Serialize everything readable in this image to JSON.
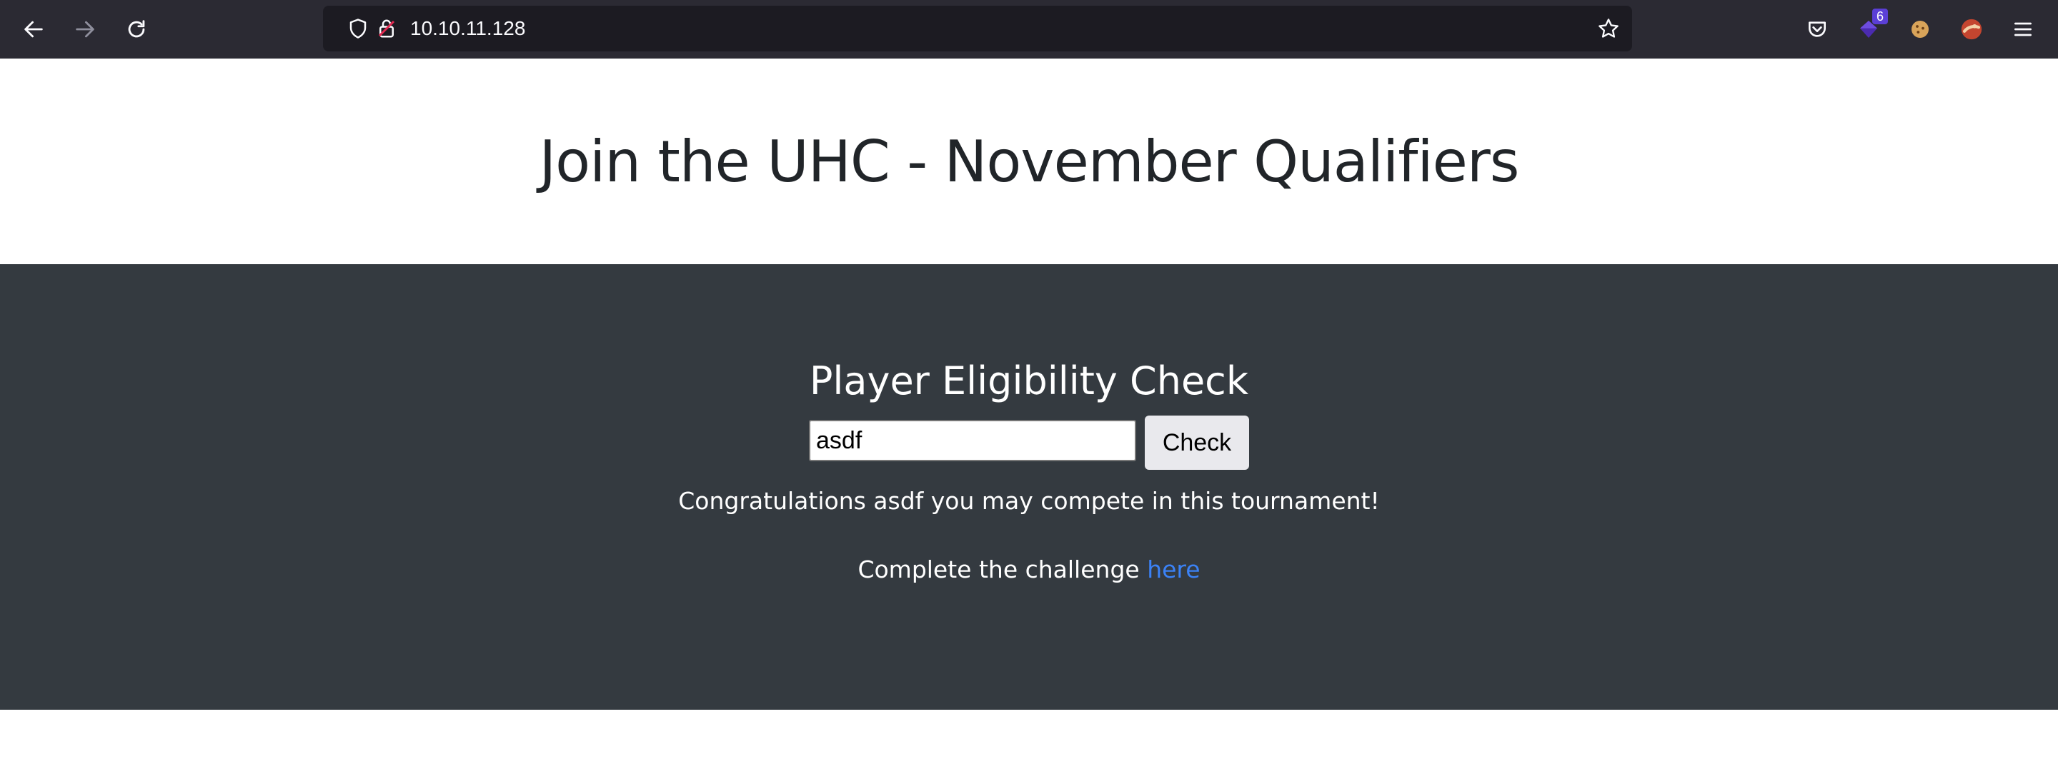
{
  "browser": {
    "url": "10.10.11.128",
    "extension_badge_count": "6"
  },
  "page": {
    "hero_title": "Join the UHC - November Qualifiers",
    "check_title": "Player Eligibility Check",
    "input_value": "asdf",
    "check_button_label": "Check",
    "result_message": "Congratulations asdf you may compete in this tournament!",
    "challenge_prefix": "Complete the challenge ",
    "challenge_link_label": "here"
  },
  "colors": {
    "browser_chrome": "#2b2a33",
    "url_bar": "#1c1b22",
    "dark_section": "#343a40",
    "link": "#3b82f6"
  }
}
